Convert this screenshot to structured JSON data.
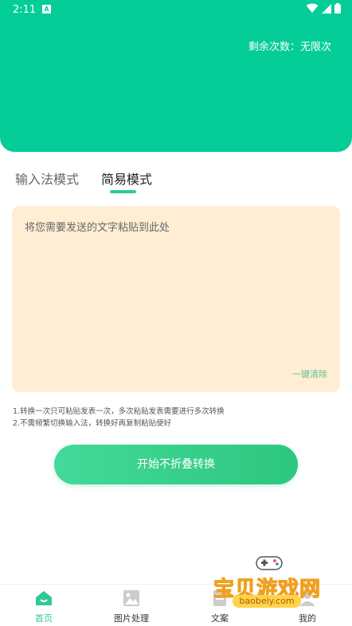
{
  "status_bar": {
    "time": "2:11",
    "app_badge": "A"
  },
  "header": {
    "remaining_label": "剩余次数：无限次"
  },
  "tabs": [
    {
      "label": "输入法模式",
      "active": false
    },
    {
      "label": "简易模式",
      "active": true
    }
  ],
  "input": {
    "placeholder": "将您需要发送的文字粘贴到此处",
    "value": "",
    "clear_label": "一键清除"
  },
  "tips": [
    "1.转换一次只可粘贴发表一次，多次粘贴发表需要进行多次转换",
    "2.不需频繁切换输入法，转换好再复制粘贴便好"
  ],
  "start_button": {
    "label": "开始不折叠转换"
  },
  "bottom_nav": [
    {
      "label": "首页",
      "icon": "home-icon",
      "active": true
    },
    {
      "label": "图片处理",
      "icon": "image-icon",
      "active": false
    },
    {
      "label": "文案",
      "icon": "document-icon",
      "active": false
    },
    {
      "label": "我的",
      "icon": "profile-icon",
      "active": false
    }
  ],
  "watermark": {
    "title": "宝贝游戏网",
    "url": "baobeiy.com"
  },
  "colors": {
    "primary": "#05cd98",
    "accent": "#2fc896",
    "input_bg": "#ffeed3"
  }
}
